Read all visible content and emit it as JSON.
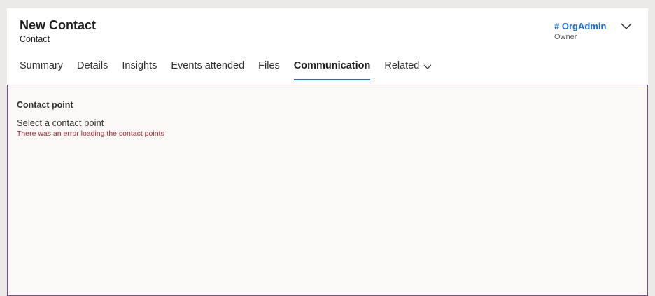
{
  "header": {
    "title": "New Contact",
    "entity_type": "Contact",
    "owner": {
      "name": "# OrgAdmin",
      "label": "Owner"
    },
    "expand_icon": "chevron-down-icon"
  },
  "tabs": [
    {
      "label": "Summary",
      "active": false
    },
    {
      "label": "Details",
      "active": false
    },
    {
      "label": "Insights",
      "active": false
    },
    {
      "label": "Events attended",
      "active": false
    },
    {
      "label": "Files",
      "active": false
    },
    {
      "label": "Communication",
      "active": true
    },
    {
      "label": "Related",
      "active": false,
      "has_dropdown": true
    }
  ],
  "content": {
    "section_label": "Contact point",
    "select_prompt": "Select a contact point",
    "error_message": "There was an error loading the contact points"
  },
  "colors": {
    "accent": "#1a6bd1",
    "error": "#a4262c",
    "focus_border": "#7b4f8e"
  }
}
